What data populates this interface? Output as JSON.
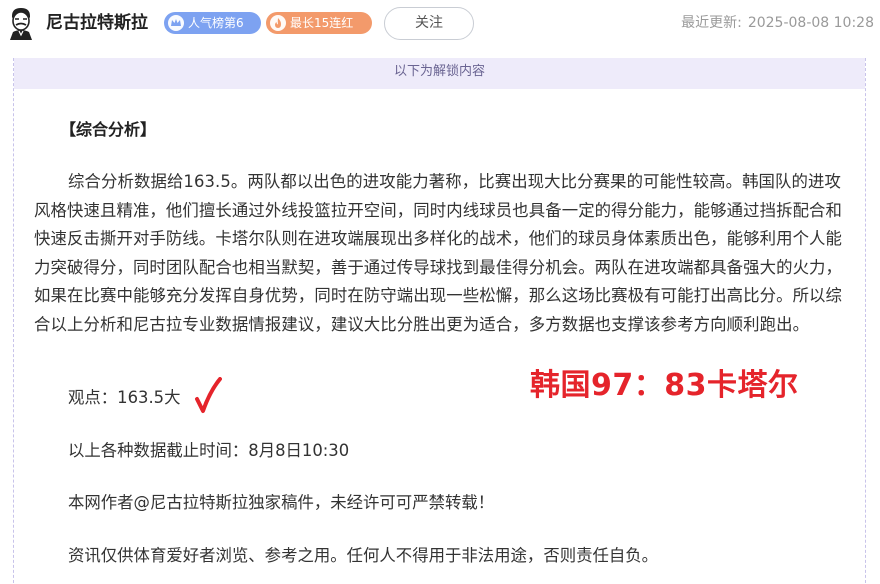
{
  "header": {
    "author_name": "尼古拉特斯拉",
    "avatar_icon": "cartoon-portrait-icon",
    "badges": [
      {
        "label": "人气榜第6",
        "icon": "crown-icon",
        "color": "#7da2f1"
      },
      {
        "label": "最长15连红",
        "icon": "flame-icon",
        "color": "#f39a6b"
      }
    ],
    "follow_label": "关注",
    "update_label": "最近更新:",
    "update_time": "2025-08-08 10:28"
  },
  "unlock_notice": "以下为解锁内容",
  "article": {
    "heading": "【综合分析】",
    "paragraph": "综合分析数据给163.5。两队都以出色的进攻能力著称，比赛出现大比分赛果的可能性较高。韩国队的进攻风格快速且精准，他们擅长通过外线投篮拉开空间，同时内线球员也具备一定的得分能力，能够通过挡拆配合和快速反击撕开对手防线。卡塔尔队则在进攻端展现出多样化的战术，他们的球员身体素质出色，能够利用个人能力突破得分，同时团队配合也相当默契，善于通过传导球找到最佳得分机会。两队在进攻端都具备强大的火力，如果在比赛中能够充分发挥自身优势，同时在防守端出现一些松懈，那么这场比赛极有可能打出高比分。所以综合以上分析和尼古拉专业数据情报建议，建议大比分胜出更为适合，多方数据也支撑该参考方向顺利跑出。",
    "opinion": "观点：163.5大",
    "result_mark": "checkmark-icon",
    "final_score": "韩国97：83卡塔尔",
    "deadline": "以上各种数据截止时间：8月8日10:30",
    "copyright": "本网作者@尼古拉特斯拉独家稿件，未经许可可严禁转载！",
    "disclaimer": "资讯仅供体育爱好者浏览、参考之用。任何人不得用于非法用途，否则责任自负。"
  },
  "colors": {
    "accent_purple": "#eeebfa",
    "score_red": "#e5242b",
    "badge_blue": "#7da2f1",
    "badge_orange": "#f39a6b"
  }
}
